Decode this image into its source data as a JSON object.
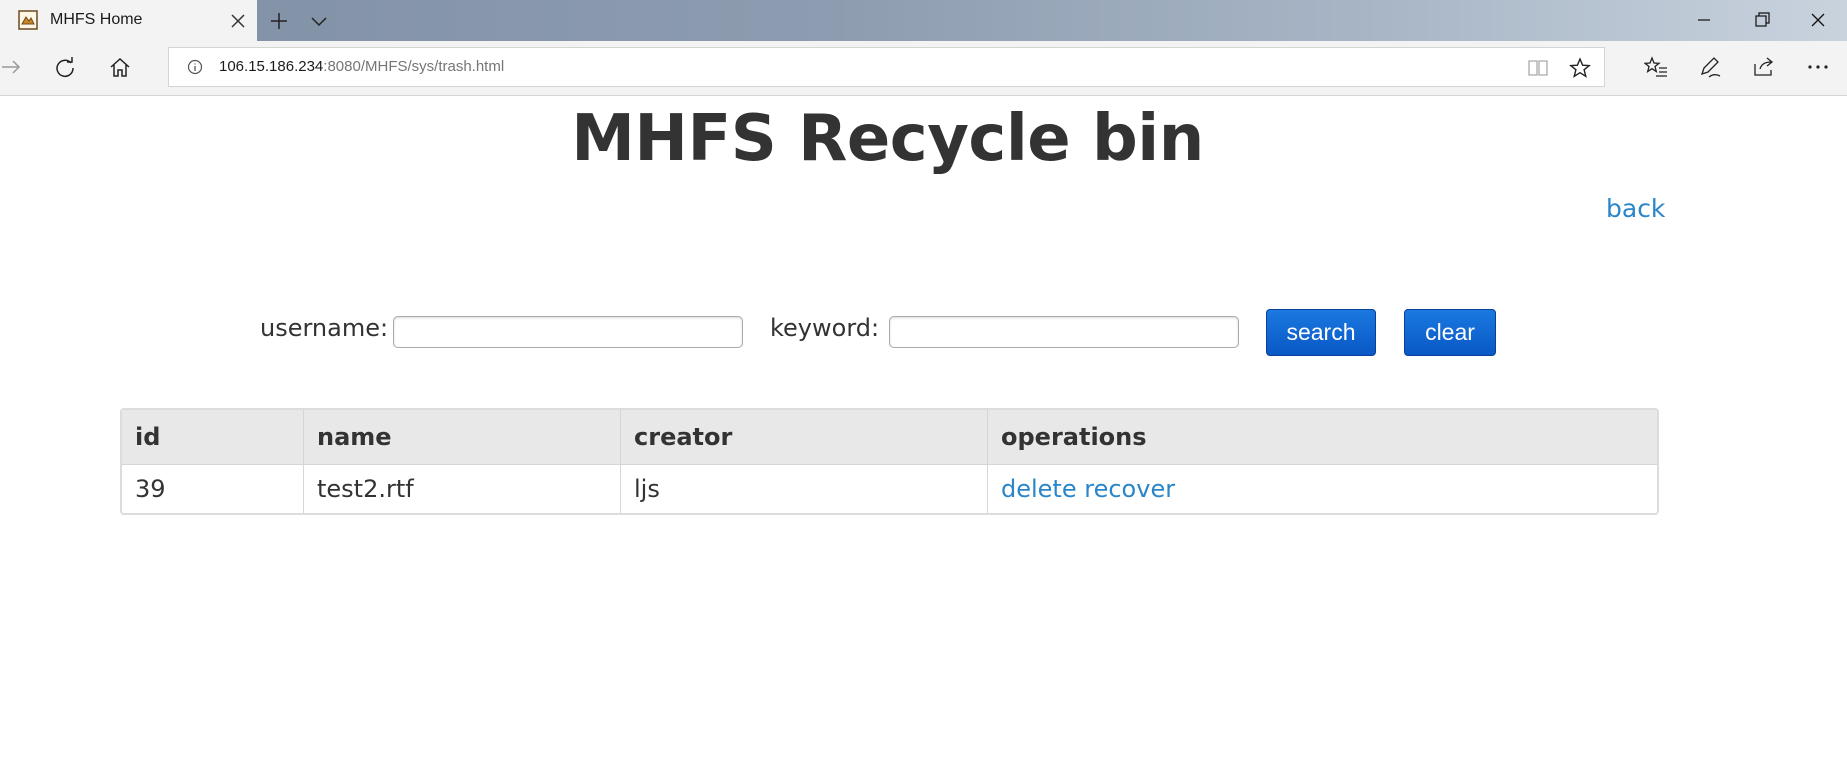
{
  "browser": {
    "tab_title": "MHFS Home",
    "address_host": "106.15.186.234",
    "address_rest": ":8080/MHFS/sys/trash.html",
    "icons": {
      "favicon": "mhfs-favicon-icon",
      "tab_close": "close-icon",
      "new_tab": "plus-icon",
      "tab_list": "chevron-down-icon",
      "forward": "arrow-right-icon",
      "refresh": "refresh-icon",
      "home": "home-icon",
      "site_info": "info-icon",
      "reading_view": "book-icon",
      "favorite": "star-icon",
      "favorites_hub": "favorites-list-icon",
      "notes": "pen-icon",
      "share": "share-icon",
      "more": "more-icon"
    }
  },
  "page": {
    "title": "MHFS Recycle bin",
    "back_label": "back",
    "search": {
      "username_label": "username:",
      "username_value": "",
      "keyword_label": "keyword:",
      "keyword_value": "",
      "search_label": "search",
      "clear_label": "clear"
    },
    "table": {
      "headers": [
        "id",
        "name",
        "creator",
        "operations"
      ],
      "rows": [
        {
          "id": "39",
          "name": "test2.rtf",
          "creator": "ljs",
          "delete_label": "delete",
          "recover_label": "recover"
        }
      ]
    }
  },
  "colors": {
    "link": "#2a86c8",
    "button": "#0a58c5",
    "header_bg": "#e8e8e8",
    "text": "#333333"
  }
}
